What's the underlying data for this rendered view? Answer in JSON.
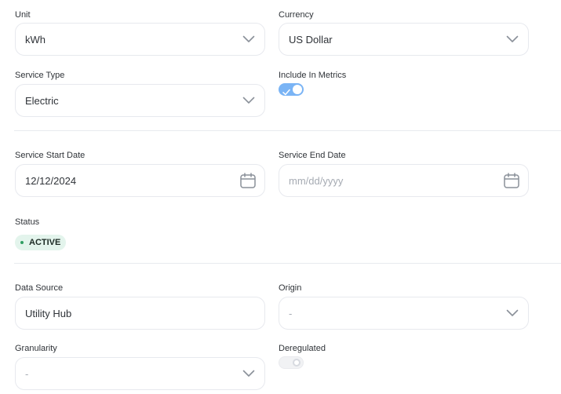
{
  "unit": {
    "label": "Unit",
    "value": "kWh"
  },
  "currency": {
    "label": "Currency",
    "value": "US Dollar"
  },
  "service_type": {
    "label": "Service Type",
    "value": "Electric"
  },
  "include_in_metrics": {
    "label": "Include In Metrics",
    "enabled": true
  },
  "service_start_date": {
    "label": "Service Start Date",
    "value": "12/12/2024"
  },
  "service_end_date": {
    "label": "Service End Date",
    "value": "",
    "placeholder": "mm/dd/yyyy"
  },
  "status": {
    "label": "Status",
    "value": "ACTIVE",
    "color": "#2f9e62"
  },
  "data_source": {
    "label": "Data Source",
    "value": "Utility Hub"
  },
  "origin": {
    "label": "Origin",
    "value": "-"
  },
  "granularity": {
    "label": "Granularity",
    "value": "-"
  },
  "deregulated": {
    "label": "Deregulated",
    "enabled": false
  },
  "colors": {
    "toggle_on": "#7ab4f5",
    "badge_bg": "#e3f4ec",
    "border": "#e7e9ee"
  }
}
